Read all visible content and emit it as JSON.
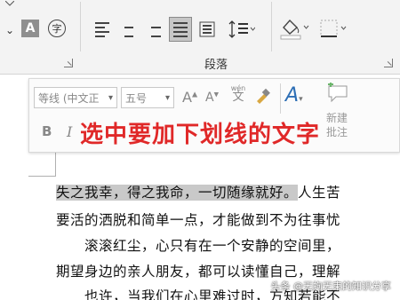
{
  "ribbon": {
    "group_label": "段落",
    "char_shading_glyph": "A",
    "enclose_char_glyph": "字",
    "left_dropdown_glyph": "⌄"
  },
  "mini_toolbar": {
    "font_name": "等线 (中文正",
    "font_size": "五号",
    "grow_font_glyph": "A",
    "shrink_font_glyph": "A",
    "phonetic_top": "wén",
    "phonetic_bottom": "文",
    "bold_glyph": "B",
    "italic_glyph": "I",
    "font_color_glyph": "A",
    "new_comment_line1": "新建",
    "new_comment_line2": "批注"
  },
  "overlay_instruction": "选中要加下划线的文字",
  "document": {
    "line1_selected": "失之我幸，得之我命，一切随缘就好。",
    "line1_rest": "人生苦",
    "line2": "要活的洒脱和简单一点，才能做到不为往事忧",
    "line3": "　　滚滚红尘，心只有在一个安静的空间里，",
    "line4": "期望身边的亲人朋友，都可以读懂自己，理解",
    "line5": "　　也许，当我们在心里难过时，方知若能不"
  },
  "watermark": "头条 @无拘无束的知识分享"
}
